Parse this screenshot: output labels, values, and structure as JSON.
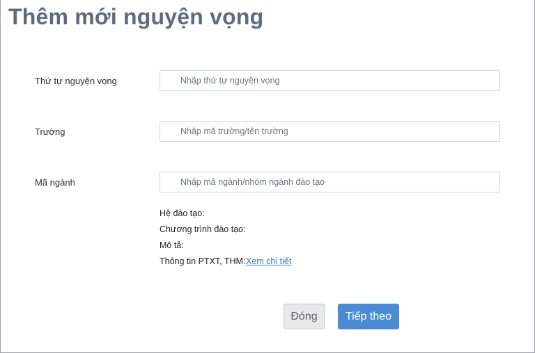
{
  "title": "Thêm mới nguyện vọng",
  "form": {
    "order": {
      "label": "Thứ tự nguyện vọng",
      "placeholder": "Nhập thứ tự nguyện vọng",
      "value": ""
    },
    "school": {
      "label": "Trường",
      "placeholder": "Nhập mã trường/tên trường",
      "value": ""
    },
    "major": {
      "label": "Mã ngành",
      "placeholder": "Nhập mã ngành/nhóm ngành đào tạo",
      "value": ""
    }
  },
  "details": {
    "training_system": "Hệ đào tạo:",
    "program": "Chương trình đào tạo:",
    "description": "Mô tả:",
    "ptxt_info": "Thông tin PTXT, THM:",
    "view_details_link": "Xem chi tiết"
  },
  "buttons": {
    "close": "Đóng",
    "next": "Tiếp theo"
  },
  "colors": {
    "title": "#5e6a80",
    "link": "#3a7cc5",
    "primary_button": "#4a8bd4",
    "secondary_button": "#e6e8eb"
  }
}
